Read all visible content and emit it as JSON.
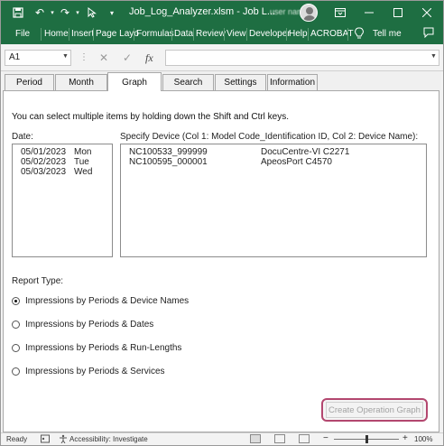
{
  "titlebar": {
    "title": "Job_Log_Analyzer.xlsm  -  Job L...",
    "user_name": "user name",
    "icons": [
      "save-icon",
      "undo-icon",
      "redo-icon",
      "cursor-icon",
      "dropdown-icon",
      "ribbon-display-icon",
      "minimize-icon",
      "maximize-icon",
      "close-icon"
    ]
  },
  "menubar": {
    "items": [
      "File",
      "Home",
      "Insert",
      "Page Layo",
      "Formulas",
      "Data",
      "Review",
      "View",
      "Developer",
      "Help",
      "ACROBAT"
    ],
    "tell_me": "Tell me"
  },
  "formulabar": {
    "cell_ref": "A1",
    "formula": ""
  },
  "tabs": [
    {
      "label": "Period",
      "active": false
    },
    {
      "label": "Month",
      "active": false
    },
    {
      "label": "Graph",
      "active": true
    },
    {
      "label": "Search",
      "active": false
    },
    {
      "label": "Settings",
      "active": false
    },
    {
      "label": "Information",
      "active": false
    }
  ],
  "graph_panel": {
    "hint": "You can select multiple items by holding down the Shift and Ctrl keys.",
    "date_label": "Date:",
    "device_label": "Specify Device (Col 1: Model Code_Identification ID, Col 2: Device Name):",
    "dates": [
      {
        "date": "05/01/2023",
        "day": "Mon"
      },
      {
        "date": "05/02/2023",
        "day": "Tue"
      },
      {
        "date": "05/03/2023",
        "day": "Wed"
      }
    ],
    "devices": [
      {
        "id": "NC100533_999999",
        "name": "DocuCentre-VI C2271"
      },
      {
        "id": "NC100595_000001",
        "name": "ApeosPort C4570"
      }
    ],
    "report_type_label": "Report Type:",
    "report_types": [
      {
        "label": "Impressions by Periods & Device Names",
        "selected": true
      },
      {
        "label": "Impressions by Periods & Dates",
        "selected": false
      },
      {
        "label": "Impressions by Periods & Run-Lengths",
        "selected": false
      },
      {
        "label": "Impressions by Periods & Services",
        "selected": false
      }
    ],
    "create_button": "Create Operation Graph"
  },
  "statusbar": {
    "ready": "Ready",
    "accessibility": "Accessibility: Investigate",
    "zoom": "100%"
  },
  "colors": {
    "excel_green": "#1e6e42",
    "highlight_border": "#b3476f"
  }
}
